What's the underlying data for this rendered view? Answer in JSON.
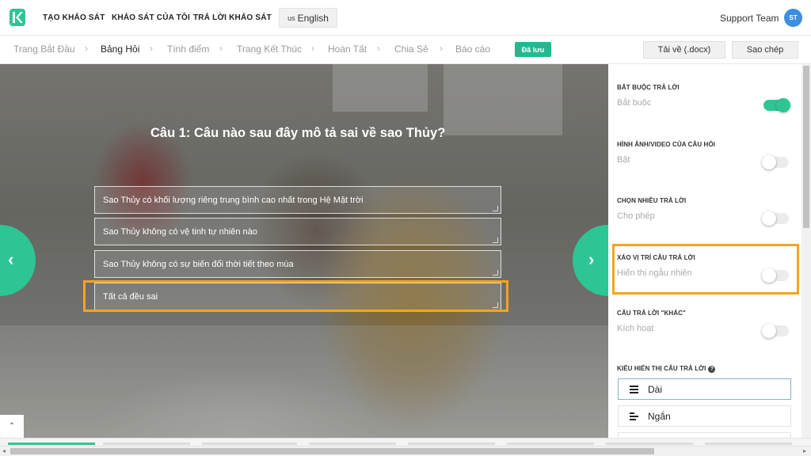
{
  "header": {
    "nav": [
      "TẠO KHẢO SÁT",
      "KHẢO SÁT CỦA TÔI",
      "TRẢ LỜI KHẢO SÁT"
    ],
    "language": {
      "flag": "us",
      "label": "English"
    },
    "team_name": "Support Team",
    "avatar_initials": "ST"
  },
  "steps": {
    "items": [
      "Trang Bắt Đầu",
      "Bảng Hỏi",
      "Tính điểm",
      "Trang Kết Thúc",
      "Hoàn Tất",
      "Chia Sẻ",
      "Báo cáo"
    ],
    "active_index": 1,
    "saved_badge": "Đã lưu",
    "download_label": "Tải về (.docx)",
    "copy_label": "Sao chép"
  },
  "question": {
    "title": "Câu 1: Câu nào sau đây mô tả sai về sao Thủy?",
    "answers": [
      "Sao Thủy có khối lượng riêng trung bình cao nhất trong Hệ Mặt trời",
      "Sao Thủy không có vệ tinh tự nhiên nào",
      "Sao Thủy không có sự biến đổi thời tiết theo mùa",
      "Tất cả đều sai"
    ],
    "highlighted_answer_index": 3
  },
  "settings": [
    {
      "label": "BẮT BUỘC TRẢ LỜI",
      "value": "Bắt buộc",
      "enabled": true
    },
    {
      "label": "HÌNH ẢNH/VIDEO CỦA CÂU HỎI",
      "value": "Bật",
      "enabled": false
    },
    {
      "label": "CHỌN NHIỀU TRẢ LỜI",
      "value": "Cho phép",
      "enabled": false
    },
    {
      "label": "XÁO VỊ TRÍ CÂU TRẢ LỜI",
      "value": "Hiển thị ngẫu nhiên",
      "enabled": false
    },
    {
      "label": "CÂU TRẢ LỜI \"KHÁC\"",
      "value": "Kích hoạt",
      "enabled": false
    }
  ],
  "display_mode": {
    "label": "KIỂU HIỂN THỊ CÂU TRẢ LỜI",
    "options": [
      "Dài",
      "Ngắn"
    ],
    "selected_index": 0
  },
  "colors": {
    "accent": "#2ec594",
    "highlight": "#f5a51b",
    "saved_badge": "#23b990",
    "avatar": "#3d8ee0"
  },
  "icons": {
    "logo": "k-logo-icon",
    "prev": "chevron-left-icon",
    "next": "chevron-right-icon",
    "scroll_top": "chevron-up-icon",
    "help": "question-circle-icon",
    "long_list": "list-long-icon",
    "short_list": "list-short-icon"
  }
}
